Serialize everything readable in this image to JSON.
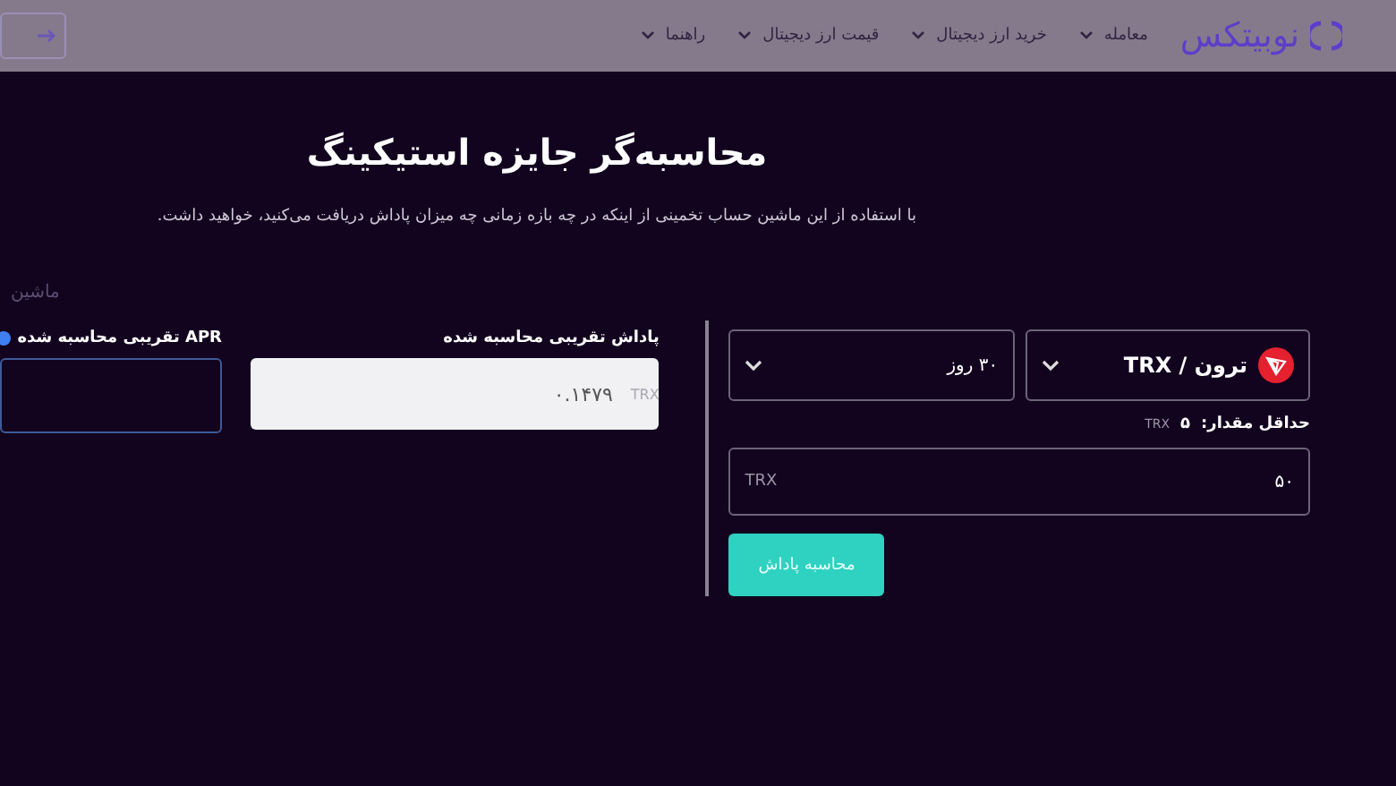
{
  "header": {
    "logo": "نوبیتکس",
    "nav": [
      {
        "label": "معامله"
      },
      {
        "label": "خرید ارز دیجیتال"
      },
      {
        "label": "قیمت ارز دیجیتال"
      },
      {
        "label": "راهنما"
      }
    ]
  },
  "title": "محاسبه‌گر جایزه استیکینگ",
  "subtitle": "با استفاده از این ماشین حساب تخمینی از اینکه در چه بازه زمانی چه میزان پاداش دریافت می‌کنید، خواهید داشت.",
  "faded_label": "ماشین",
  "form": {
    "coin": "ترون / TRX",
    "period": "۳۰ روز",
    "min_label": "حداقل مقدار:",
    "min_value": "۵",
    "min_unit": "TRX",
    "amount": "۵۰",
    "amount_unit": "TRX",
    "button": "محاسبه پاداش"
  },
  "result": {
    "reward_label": "پاداش تقریبی محاسبه شده",
    "reward_value": "۰.۱۴۷۹",
    "reward_unit": "TRX",
    "apr_label": "APR تقریبی محاسبه شده"
  }
}
